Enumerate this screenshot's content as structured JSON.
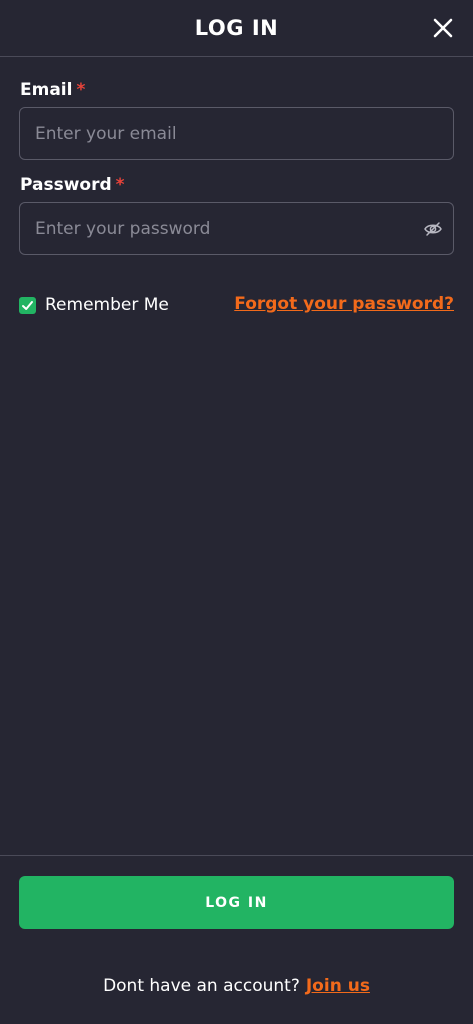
{
  "header": {
    "title": "LOG IN",
    "close_icon": "close-icon"
  },
  "form": {
    "email": {
      "label": "Email",
      "required_mark": "*",
      "placeholder": "Enter your email",
      "value": ""
    },
    "password": {
      "label": "Password",
      "required_mark": "*",
      "placeholder": "Enter your password",
      "value": "",
      "toggle_icon": "eye-off-icon"
    },
    "remember": {
      "label": "Remember Me",
      "checked": true
    },
    "forgot_link": "Forgot your password?"
  },
  "footer": {
    "login_button": "LOG IN",
    "signup_prompt": "Dont have an account?",
    "join_link": "Join us"
  },
  "colors": {
    "background": "#262633",
    "accent_green": "#22b463",
    "link_orange": "#f26a1b",
    "required_red": "#e8433a"
  }
}
